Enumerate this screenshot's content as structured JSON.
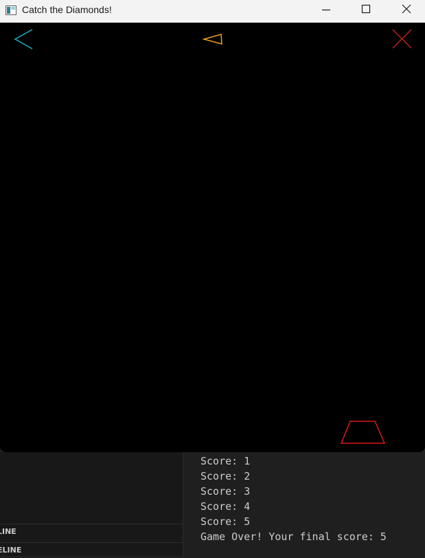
{
  "window": {
    "title": "Catch the Diamonds!",
    "controls": [
      "minimize",
      "maximize",
      "close"
    ]
  },
  "game": {
    "back_icon_color": "#1fb2c4",
    "diamond_color": "#f0a020",
    "close_icon_color": "#c0201c",
    "basket_color": "#d81818",
    "background": "#000000"
  },
  "side_panel": {
    "rows": [
      "LINE",
      "ELINE"
    ]
  },
  "terminal": {
    "lines": [
      "Score: 1",
      "Score: 2",
      "Score: 3",
      "Score: 4",
      "Score: 5",
      "Game Over! Your final score: 5"
    ]
  }
}
